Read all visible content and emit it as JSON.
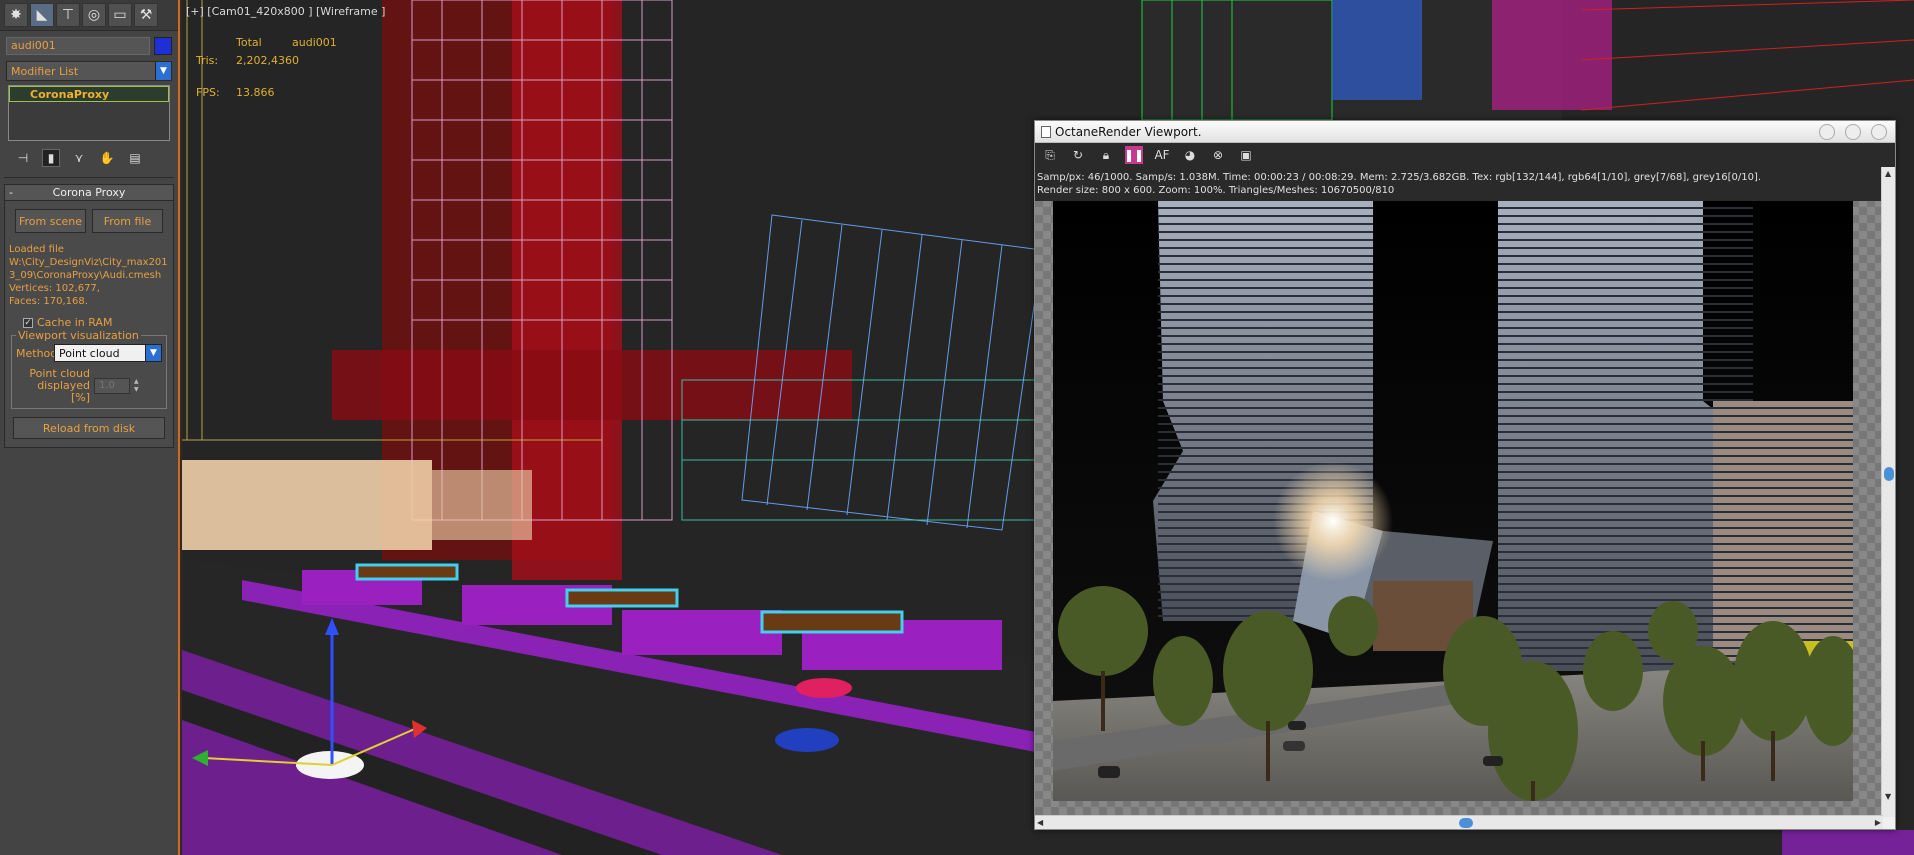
{
  "panel": {
    "object_name": "audi001",
    "modifier_list": "Modifier List",
    "stack_item": "CoronaProxy",
    "rollout_title": "Corona Proxy",
    "from_scene": "From scene",
    "from_file": "From file",
    "loaded_label": "Loaded file",
    "loaded_path": "W:\\City_DesignViz\\City_max2013_09\\CoronaProxy\\Audi.cmesh",
    "vertices": "Vertices: 102,677,",
    "faces": "Faces: 170,168.",
    "cache_label": "Cache in RAM",
    "viz_group": "Viewport visualization",
    "method_label": "Method",
    "method_value": "Point cloud",
    "pc_label": "Point cloud displayed [%]",
    "pc_value": "1.0",
    "reload": "Reload from disk"
  },
  "viewport": {
    "label": "[+] [Cam01_420x800 ] [Wireframe ]",
    "total_label": "Total",
    "object_label": "audi001",
    "tris_label": "Tris:",
    "tris_total": "2,202,436",
    "tris_obj": "0",
    "fps_label": "FPS:",
    "fps_value": "13.866"
  },
  "octane": {
    "title": "OctaneRender Viewport.",
    "info_line1": "Samp/px: 46/1000.   Samp/s: 1.038M.   Time: 00:00:23 / 00:08:29.   Mem: 2.725/3.682GB.   Tex: rgb[132/144], rgb64[1/10], grey[7/68], grey16[0/10].",
    "info_line2": "Render size: 800 x 600.   Zoom: 100%.   Triangles/Meshes: 10670500/810"
  },
  "colors": {
    "accent": "#d2691e",
    "panel_bg": "#444444",
    "label_orange": "#e8a040",
    "octane_pause": "#c43b8e"
  }
}
